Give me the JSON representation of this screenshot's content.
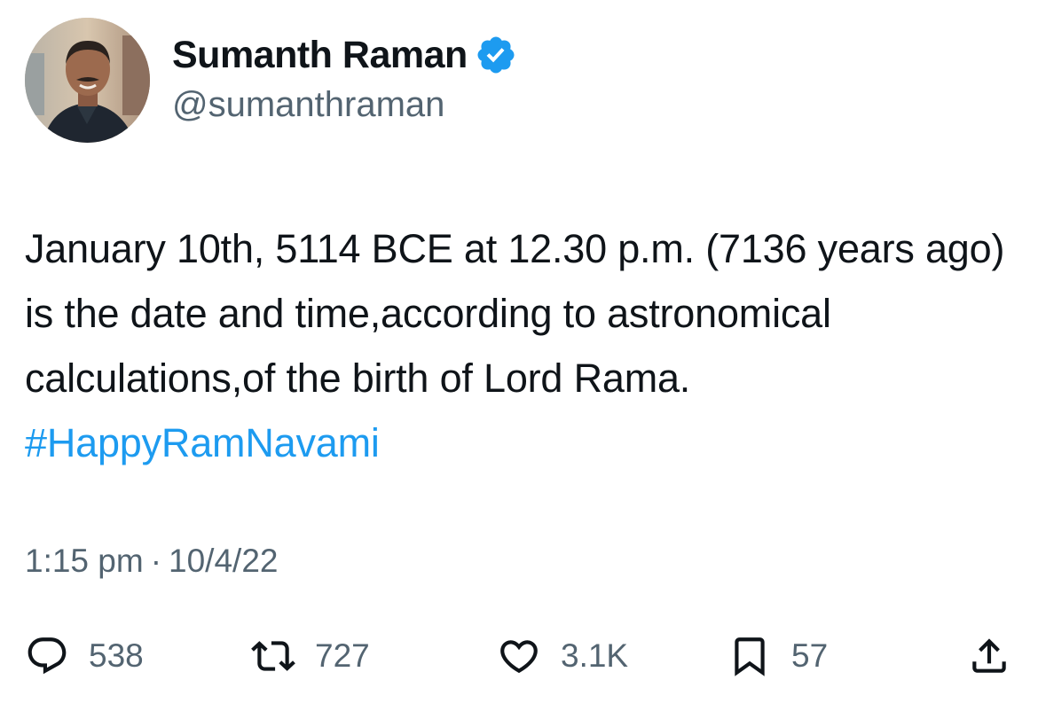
{
  "author": {
    "display_name": "Sumanth Raman",
    "handle": "@sumanthraman",
    "verified": true,
    "verified_color": "#1d9bf0"
  },
  "tweet": {
    "text_plain": "January 10th, 5114 BCE at 12.30 p.m. (7136 years ago) is the date and time,according to astronomical calculations,of the birth of Lord Rama. ",
    "hashtag": "#HappyRamNavami",
    "hashtag_color": "#1d9bf0"
  },
  "meta": {
    "time": "1:15 pm",
    "separator": "·",
    "date": "10/4/22"
  },
  "actions": {
    "reply": {
      "icon": "reply-icon",
      "count": "538"
    },
    "retweet": {
      "icon": "retweet-icon",
      "count": "727"
    },
    "like": {
      "icon": "heart-icon",
      "count": "3.1K"
    },
    "bookmark": {
      "icon": "bookmark-icon",
      "count": "57"
    },
    "share": {
      "icon": "share-icon"
    }
  }
}
